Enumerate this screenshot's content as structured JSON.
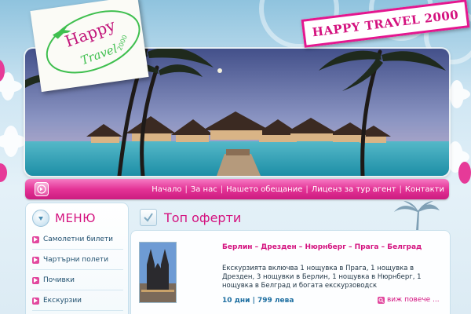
{
  "logo": {
    "word_top": "Happy",
    "word_bottom": "Travel",
    "year": "2000"
  },
  "stamp": {
    "text": "HAPPY TRAVEL 2000"
  },
  "nav": {
    "items": [
      "Начало",
      "За нас",
      "Нашето обещание",
      "Лиценз за тур агент",
      "Контакти"
    ],
    "separator": "|"
  },
  "menu": {
    "title": "МЕНЮ",
    "items": [
      "Самолетни билети",
      "Чартърни полети",
      "Почивки",
      "Екскурзии"
    ]
  },
  "section": {
    "title": "Топ оферти"
  },
  "offer": {
    "route": "Берлин – Дрезден – Нюрнберг – Прага – Белград",
    "description": "Екскурзията включва 1 нощувка в Прага, 1 нощувка в Дрезден, 3 нощувки в Берлин, 1 нощувка в Нюрнберг, 1 нощувка в Белград и богата екскурзоводск",
    "meta": "10 дни | 799 лева",
    "more": "виж повече ..."
  },
  "colors": {
    "brand_pink": "#d4127f",
    "nav_pink": "#e43396",
    "link_blue": "#1e6fa1"
  },
  "icons": {
    "nav_home": "arrow-right-circle-icon",
    "menu_badge": "arrow-down-icon",
    "section_badge": "checkmark-icon",
    "menu_bullet": "arrow-right-icon",
    "more": "magnifier-icon"
  }
}
